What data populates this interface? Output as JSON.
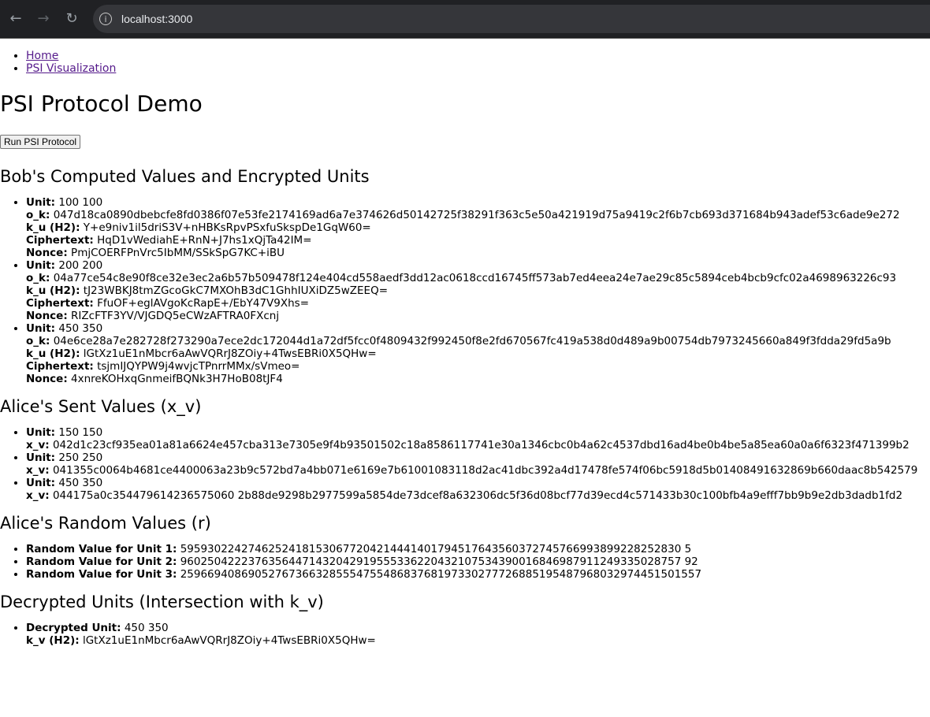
{
  "browser": {
    "url": "localhost:3000"
  },
  "nav": {
    "links": [
      "Home",
      "PSI Visualization"
    ]
  },
  "page_title": "PSI Protocol Demo",
  "run_button": "Run PSI Protocol",
  "bob": {
    "heading": "Bob's Computed Values and Encrypted Units",
    "items": [
      {
        "unit": "100 100",
        "o_k": "047d18ca0890dbebcfe8fd0386f07e53fe2174169ad6a7e374626d50142725f38291f363c5e50a421919d75a9419c2f6b7cb693d371684b943adef53c6ade9e272",
        "k_u": "Y+e9niv1il5driS3V+nHBKsRpvPSxfuSkspDe1GqW60=",
        "ciphertext": "HqD1vWediahE+RnN+J7hs1xQjTa42IM=",
        "nonce": "PmjCOERFPnVrc5IbMM/SSkSpG7KC+iBU"
      },
      {
        "unit": "200 200",
        "o_k": "04a77ce54c8e90f8ce32e3ec2a6b57b509478f124e404cd558aedf3dd12ac0618ccd16745ff573ab7ed4eea24e7ae29c85c5894ceb4bcb9cfc02a4698963226c93",
        "k_u": "tJ23WBKJ8tmZGcoGkC7MXOhB3dC1GhhIUXiDZ5wZEEQ=",
        "ciphertext": "FfuOF+eglAVgoKcRapE+/EbY47V9Xhs=",
        "nonce": "RIZcFTF3YV/VJGDQ5eCWzAFTRA0FXcnj"
      },
      {
        "unit": "450 350",
        "o_k": "04e6ce28a7e282728f273290a7ece2dc172044d1a72df5fcc0f4809432f992450f8e2fd670567fc419a538d0d489a9b00754db7973245660a849f3fdda29fd5a9b",
        "k_u": "lGtXz1uE1nMbcr6aAwVQRrJ8ZOiy+4TwsEBRi0X5QHw=",
        "ciphertext": "tsjmIJQYPW9j4wvjcTPnrrMMx/sVmeo=",
        "nonce": "4xnreKOHxqGnmeifBQNk3H7HoB08tJF4"
      }
    ],
    "labels": {
      "unit": "Unit:",
      "o_k": "o_k:",
      "k_u": "k_u (H2):",
      "ciphertext": "Ciphertext:",
      "nonce": "Nonce:"
    }
  },
  "alice_sent": {
    "heading": "Alice's Sent Values (x_v)",
    "labels": {
      "unit": "Unit:",
      "x_v": "x_v:"
    },
    "items": [
      {
        "unit": "150 150",
        "x_v": "042d1c23cf935ea01a81a6624e457cba313e7305e9f4b93501502c18a8586117741e30a1346cbc0b4a62c4537dbd16ad4be0b4be5a85ea60a0a6f6323f471399b2"
      },
      {
        "unit": "250 250",
        "x_v": "041355c0064b4681ce4400063a23b9c572bd7a4bb071e6169e7b61001083118d2ac41dbc392a4d17478fe574f06bc5918d5b01408491632869b660daac8b542579"
      },
      {
        "unit": "450 350",
        "x_v": "044175a0c354479614236575060 2b88de9298b2977599a5854de73dcef8a632306dc5f36d08bcf77d39ecd4c571433b30c100bfb4a9efff7bb9b9e2db3dadb1fd2"
      }
    ]
  },
  "alice_random": {
    "heading": "Alice's Random Values (r)",
    "items": [
      {
        "label": "Random Value for Unit 1:",
        "value": "59593022427462524181530677204214441401794517643560372745766993899228252830 5"
      },
      {
        "label": "Random Value for Unit 2:",
        "value": "96025042223763564471432042919555336220432107534390016846987911249335028757 92"
      },
      {
        "label": "Random Value for Unit 3:",
        "value": "25966940869052767366328555475548683768197330277726885195487968032974451501557"
      }
    ]
  },
  "decrypted": {
    "heading": "Decrypted Units (Intersection with k_v)",
    "items": [
      {
        "unit_label": "Decrypted Unit:",
        "unit": "450 350",
        "kv_label": "k_v (H2):",
        "k_v": "lGtXz1uE1nMbcr6aAwVQRrJ8ZOiy+4TwsEBRi0X5QHw="
      }
    ]
  }
}
